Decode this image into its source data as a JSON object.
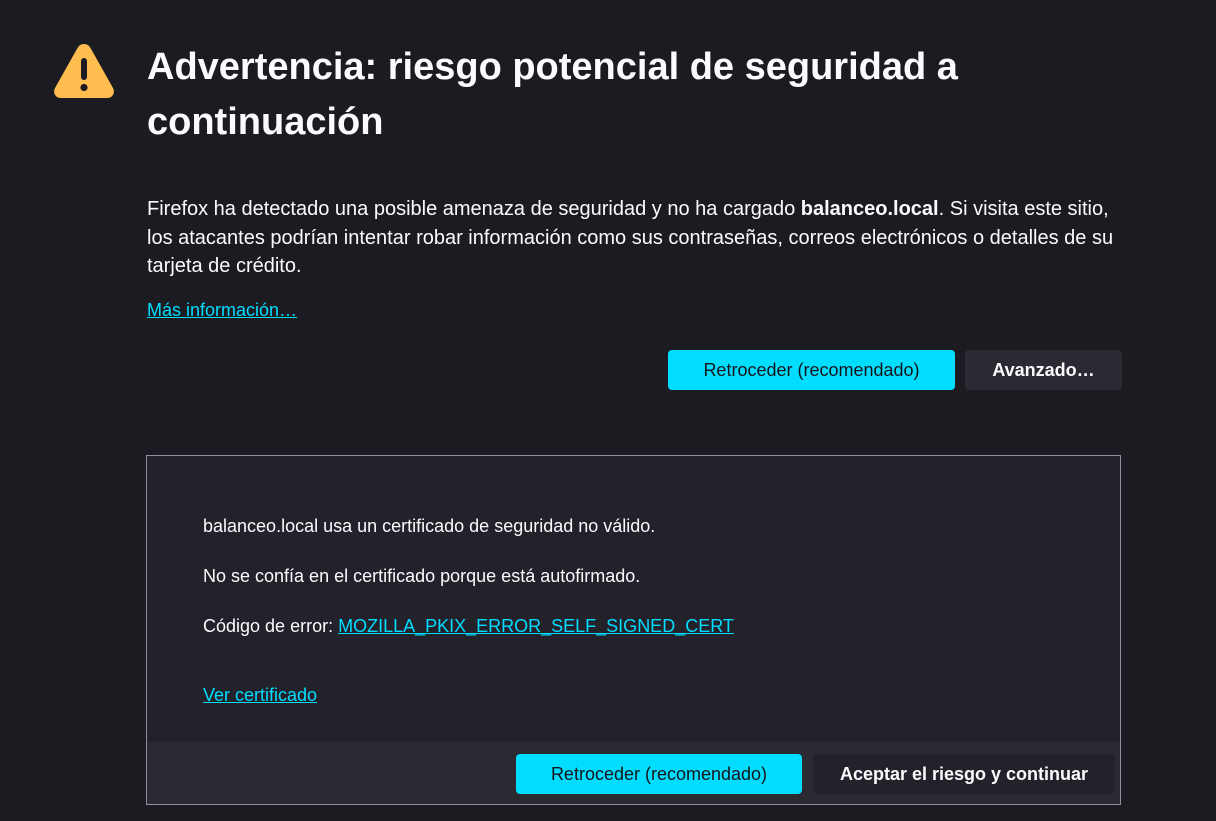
{
  "header": {
    "icon": "warning-triangle-icon",
    "title": "Advertencia: riesgo potencial de seguridad a continuación"
  },
  "intro": {
    "before_host": "Firefox ha detectado una posible amenaza de seguridad y no ha cargado ",
    "host": "balanceo.local",
    "after_host": ". Si visita este sitio, los atacantes podrían intentar robar información como sus contraseñas, correos electrónicos o detalles de su tarjeta de crédito."
  },
  "links": {
    "more_info": "Más información…"
  },
  "actions": {
    "go_back": "Retroceder (recomendado)",
    "advanced": "Avanzado…"
  },
  "advanced_panel": {
    "line1": "balanceo.local usa un certificado de seguridad no válido.",
    "line2": "No se confía en el certificado porque está autofirmado.",
    "error_label": "Código de error: ",
    "error_code": "MOZILLA_PKIX_ERROR_SELF_SIGNED_CERT",
    "view_certificate": "Ver certificado",
    "go_back": "Retroceder (recomendado)",
    "accept_risk": "Aceptar el riesgo y continuar"
  },
  "colors": {
    "background": "#1c1b22",
    "accent": "#00ddff",
    "warning": "#ffbd4f",
    "panel": "#23222b"
  }
}
